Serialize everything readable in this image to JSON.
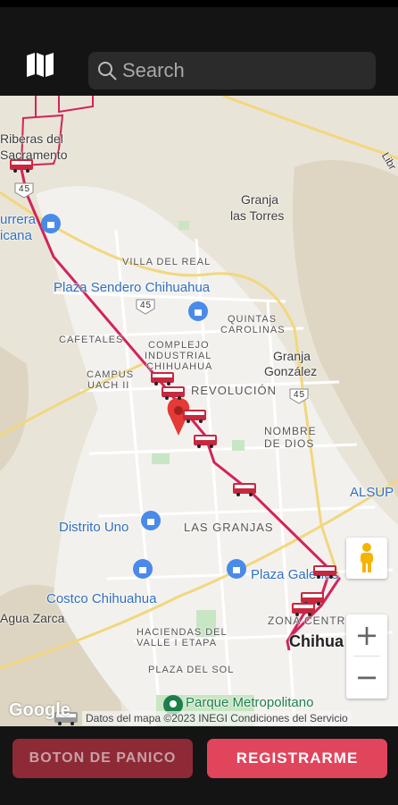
{
  "header": {
    "search_placeholder": "Search",
    "map_icon": "map-icon",
    "search_icon": "search-icon"
  },
  "map": {
    "labels": {
      "riberas": "Riberas del",
      "sacramento": "Sacramento",
      "granja_torres_1": "Granja",
      "granja_torres_2": "las Torres",
      "currera": "urrera",
      "icana": "icana",
      "villa_real": "VILLA DEL REAL",
      "plaza_sendero": "Plaza Sendero Chihuahua",
      "quintas": "QUINTAS",
      "carolinas": "CAROLINAS",
      "cafetales": "CAFETALES",
      "complejo": "COMPLEJO",
      "industrial": "INDUSTRIAL",
      "chihuahua_small": "CHIHUAHUA",
      "granja_gonzalez_1": "Granja",
      "granja_gonzalez_2": "González",
      "campus": "CAMPUS",
      "uach": "UACH II",
      "revolucion": "REVOLUCIÓN",
      "nombre_de": "NOMBRE",
      "dios": "DE DIOS",
      "alsup": "ALSUP",
      "distrito_uno": "Distrito Uno",
      "las_granjas": "LAS GRANJAS",
      "plaza_galerias": "Plaza Galerías",
      "costco": "Costco Chihuahua",
      "agua_zarca": "Agua Zarca",
      "zona_centro": "ZONA CENTRO",
      "chihuahua_big": "Chihua",
      "haciendas": "HACIENDAS DEL",
      "valle": "VALLE I ETAPA",
      "plaza_sol": "PLAZA DEL SOL",
      "parque": "Parque Metropolitano",
      "road_45": "45",
      "road_45b": "45",
      "road_45c": "45",
      "libre": "Libr"
    },
    "google_logo": "Google",
    "attribution": "Datos del mapa ©2023 INEGI   Condiciones del Servicio",
    "route_color": "#d2245a",
    "zoom_in": "+",
    "zoom_out": "−"
  },
  "footer": {
    "panic_label": "BOTON DE PANICO",
    "register_label": "REGISTRARME"
  }
}
